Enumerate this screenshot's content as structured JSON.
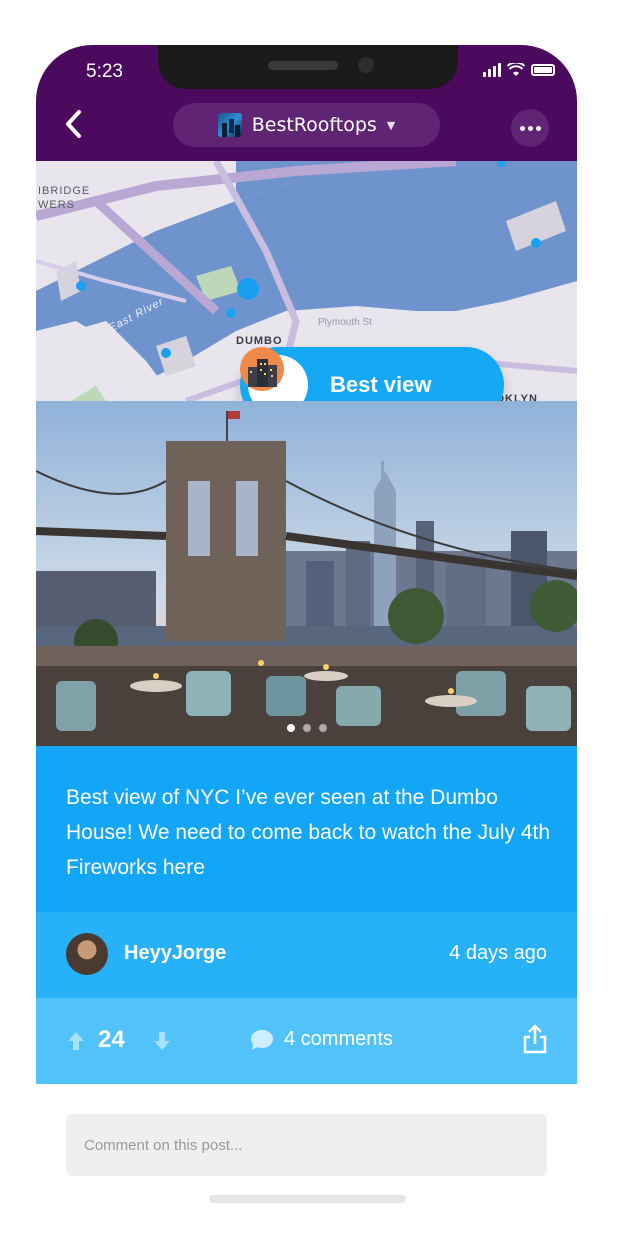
{
  "status_bar": {
    "time": "5:23"
  },
  "nav": {
    "channel_name": "BestRooftops",
    "colors": {
      "header": "#4b0a5e",
      "pill": "#5f2473"
    }
  },
  "map": {
    "labels": [
      "IBRIDGE",
      "WERS",
      "East River",
      "DUMBO",
      "Plymouth St",
      "BROOKLYN"
    ],
    "pin_label": "Best view"
  },
  "photo": {
    "carousel_count": 3,
    "carousel_active": 1
  },
  "post": {
    "caption": "Best view of NYC I’ve ever seen at the Dumbo House! We need to come back to watch the July 4th Fireworks here",
    "author": "HeyyJorge",
    "time_ago": "4 days ago",
    "votes": "24",
    "comments_label": "4 comments",
    "colors": {
      "caption_bg": "#13a5f6",
      "author_bg": "#26b1f8",
      "actions_bg": "#52c3fa"
    }
  },
  "comment_input": {
    "placeholder": "Comment on this post..."
  }
}
